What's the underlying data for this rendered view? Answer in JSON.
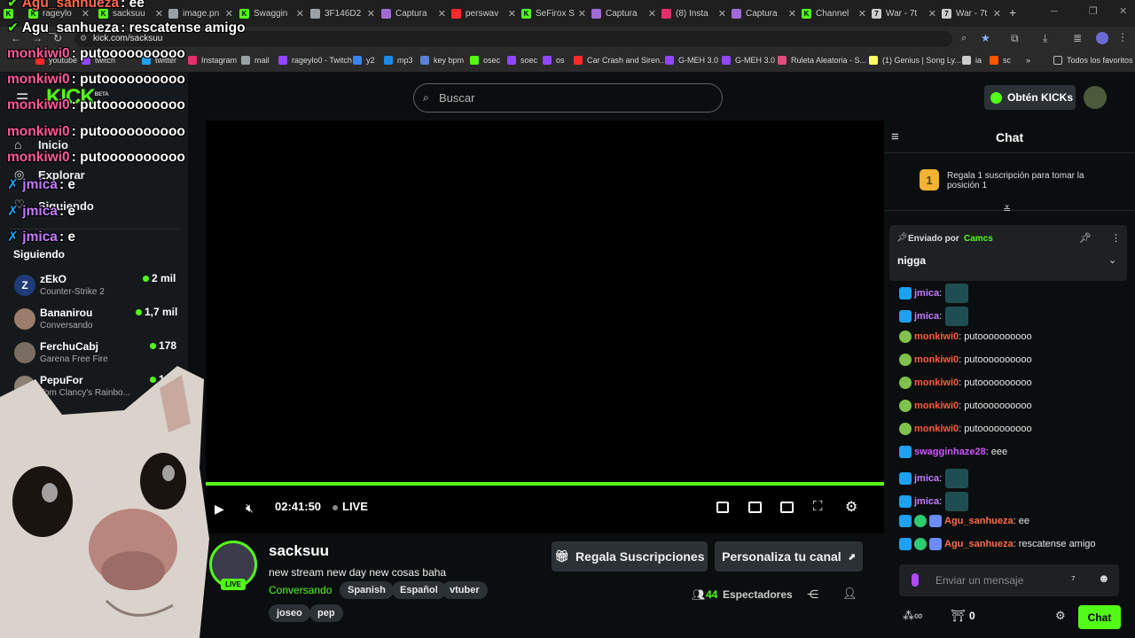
{
  "tabs": [
    {
      "label": "rageylo",
      "color": "#53fc18"
    },
    {
      "label": "sacksuu",
      "color": "#53fc18"
    },
    {
      "label": "image.pn",
      "color": "#9aa0a6"
    },
    {
      "label": "Swaggin",
      "color": "#53fc18"
    },
    {
      "label": "3F146D2",
      "color": "#9aa0a6"
    },
    {
      "label": "Captura",
      "color": "#a06bd6"
    },
    {
      "label": "perswav",
      "color": "#ff2a2a"
    },
    {
      "label": "SeFirox S",
      "color": "#53fc18"
    },
    {
      "label": "Captura",
      "color": "#a06bd6"
    },
    {
      "label": "(8) Insta",
      "color": "#e1306c"
    },
    {
      "label": "Captura",
      "color": "#a06bd6"
    },
    {
      "label": "Channel",
      "color": "#53fc18"
    },
    {
      "label": "War - 7t",
      "color": "#cccccc"
    },
    {
      "label": "War - 7t",
      "color": "#cccccc"
    }
  ],
  "url": "kick.com/sacksuu",
  "bookmarks": [
    {
      "label": "youtube",
      "color": "#ff2a2a"
    },
    {
      "label": "twitch",
      "color": "#9146ff"
    },
    {
      "label": "twitter",
      "color": "#1da1f2"
    },
    {
      "label": "Instagram",
      "color": "#e1306c"
    },
    {
      "label": "mail",
      "color": "#9aa0a6"
    },
    {
      "label": "rageylo0 - Twitch",
      "color": "#9146ff"
    },
    {
      "label": "y2",
      "color": "#3b82f6"
    },
    {
      "label": "mp3",
      "color": "#1e88e5"
    },
    {
      "label": "key bpm",
      "color": "#5a7fd6"
    },
    {
      "label": "osec",
      "color": "#53fc18"
    },
    {
      "label": "soec",
      "color": "#9146ff"
    },
    {
      "label": "os",
      "color": "#9146ff"
    },
    {
      "label": "Car Crash and Siren...",
      "color": "#ff2a2a"
    },
    {
      "label": "G-MEH 3.0",
      "color": "#9146ff"
    },
    {
      "label": "G-MEH 3.0",
      "color": "#9146ff"
    },
    {
      "label": "Ruleta Aleatoria - S...",
      "color": "#e34d7b"
    },
    {
      "label": "(1) Genius | Song Ly...",
      "color": "#ffff64"
    },
    {
      "label": "ia",
      "color": "#cccccc"
    },
    {
      "label": "sc",
      "color": "#ff5500"
    }
  ],
  "bookmarks_all": "Todos los favoritos",
  "header": {
    "logo": "KICK",
    "logo_sup": "BETA",
    "search_placeholder": "Buscar",
    "get_kicks": "Obtén KICKs"
  },
  "sidebar": {
    "nav": [
      "Inicio",
      "Explorar",
      "Siguiendo"
    ],
    "section_title": "Siguiendo",
    "following": [
      {
        "name": "zEkO",
        "category": "Counter-Strike 2",
        "viewers": "2 mil"
      },
      {
        "name": "Bananirou",
        "category": "Conversando",
        "viewers": "1,7 mil"
      },
      {
        "name": "FerchuCabj",
        "category": "Garena Free Fire",
        "viewers": "178"
      },
      {
        "name": "PepuFor",
        "category": "Tom Clancy's Rainbo...",
        "viewers": "10"
      }
    ]
  },
  "overlay_chat": [
    {
      "user": "Agu_sanhueza",
      "text": "ee",
      "color": "#ffffff"
    },
    {
      "user": "Agu_sanhueza",
      "text": "rescatense amigo",
      "color": "#ffffff"
    },
    {
      "user": "monkiwi0",
      "text": "putoooooooooo",
      "color": "#ffffff"
    },
    {
      "user": "monkiwi0",
      "text": "putoooooooooo",
      "color": "#ffffff"
    },
    {
      "user": "monkiwi0",
      "text": "putoooooooooo",
      "color": "#ffffff"
    },
    {
      "user": "monkiwi0",
      "text": "putoooooooooo",
      "color": "#ffffff"
    },
    {
      "user": "monkiwi0",
      "text": "putoooooooooo",
      "color": "#ffffff"
    },
    {
      "user": "jmica",
      "text": "e",
      "color": "#c47cff"
    },
    {
      "user": "jmica",
      "text": "e",
      "color": "#c47cff"
    },
    {
      "user": "jmica",
      "text": "e",
      "color": "#c47cff"
    }
  ],
  "player": {
    "time": "02:41:50",
    "live_label": "LIVE",
    "progress": 1.0
  },
  "stream": {
    "channel": "sacksuu",
    "title": "new stream new day new cosas baha",
    "category": "Conversando",
    "tags": [
      "Spanish",
      "Español",
      "vtuber"
    ],
    "tags2": [
      "joseo",
      "pep"
    ],
    "live_badge": "LIVE",
    "gift_button": "Regala Suscripciones",
    "customize_button": "Personaliza tu canal",
    "viewers_count": "44",
    "viewers_label": "Espectadores"
  },
  "chat": {
    "title": "Chat",
    "gift_rank": "1",
    "gift_prompt": "Regala 1 suscripción para tomar la posición 1",
    "pinned_by_label": "Enviado por",
    "pinned_by_user": "Camcs",
    "pinned_message": "nigga",
    "messages": [
      {
        "user": "jmica",
        "text": "",
        "color": "#c47cff",
        "emote": true
      },
      {
        "user": "jmica",
        "text": "",
        "color": "#c47cff",
        "emote": true
      },
      {
        "user": "monkiwi0",
        "text": "putoooooooooo",
        "color": "#ff5a3c",
        "emote": false
      },
      {
        "user": "monkiwi0",
        "text": "putoooooooooo",
        "color": "#ff5a3c",
        "emote": false
      },
      {
        "user": "monkiwi0",
        "text": "putoooooooooo",
        "color": "#ff5a3c",
        "emote": false
      },
      {
        "user": "monkiwi0",
        "text": "putoooooooooo",
        "color": "#ff5a3c",
        "emote": false
      },
      {
        "user": "monkiwi0",
        "text": "putoooooooooo",
        "color": "#ff5a3c",
        "emote": false
      },
      {
        "user": "swagginhaze28",
        "text": "eee",
        "color": "#d154ff",
        "emote": false
      },
      {
        "user": "jmica",
        "text": "",
        "color": "#c47cff",
        "emote": true
      },
      {
        "user": "jmica",
        "text": "",
        "color": "#c47cff",
        "emote": true
      },
      {
        "user": "Agu_sanhueza",
        "text": "ee",
        "color": "#ff6b4a",
        "emote": false
      },
      {
        "user": "Agu_sanhueza",
        "text": "rescatense amigo",
        "color": "#ff6b4a",
        "emote": false
      }
    ],
    "input_placeholder": "Enviar un mensaje",
    "kicks_count": "0",
    "send_button": "Chat"
  },
  "colors": {
    "accent": "#53fc18",
    "bg": "#0b0e0f",
    "panel": "#16191b"
  }
}
